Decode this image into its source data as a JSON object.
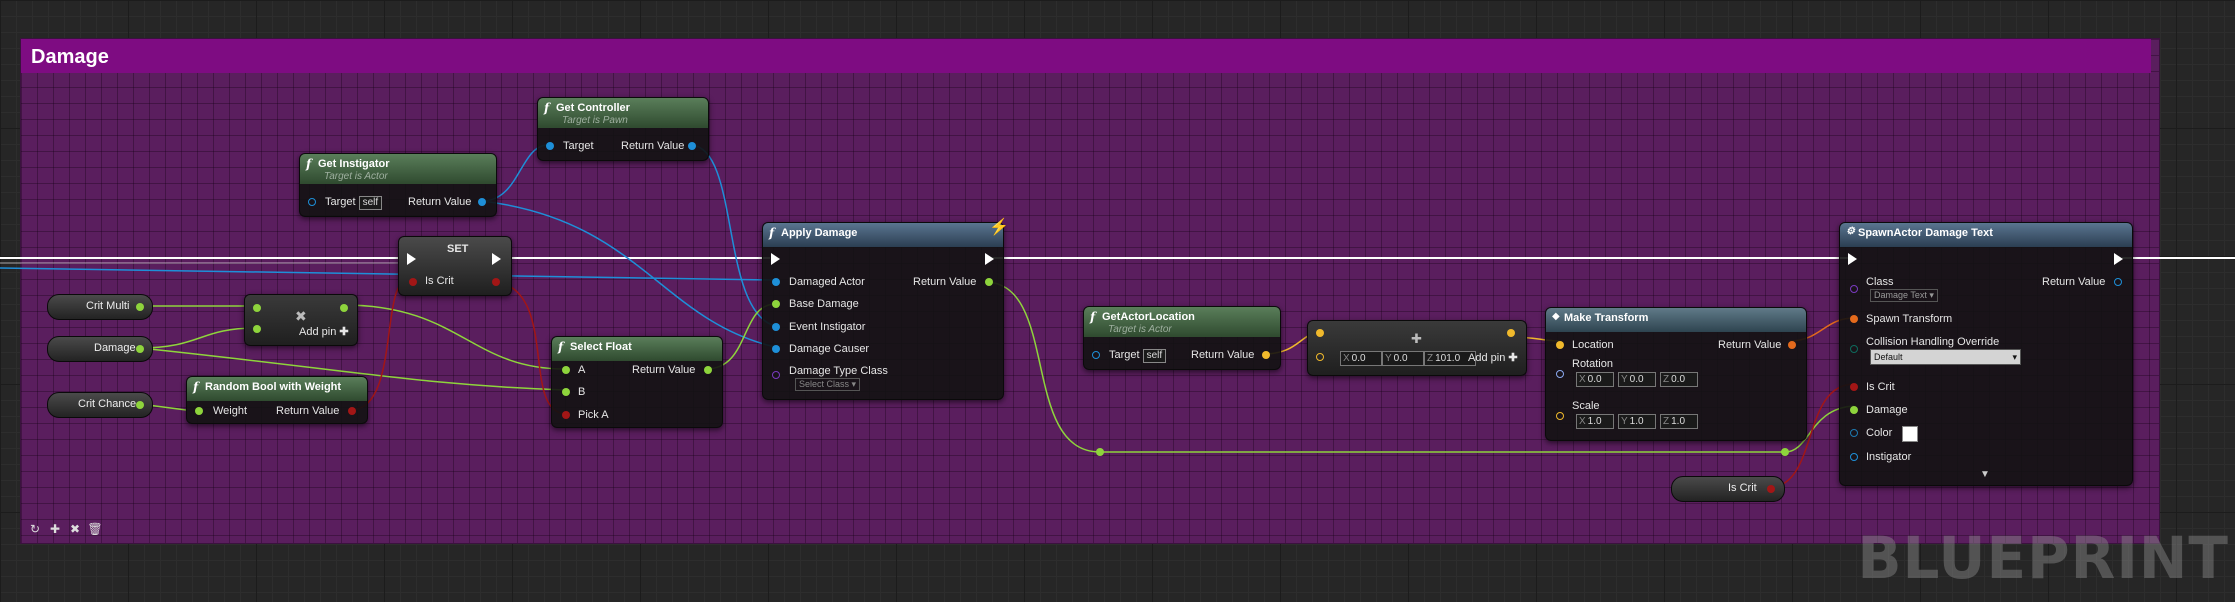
{
  "comment": {
    "title": "Damage"
  },
  "watermark": "BLUEPRINT",
  "colors": {
    "exec": "#ffffff",
    "object": "#1e8fd8",
    "float": "#8ed43c",
    "bool": "#a21616",
    "vector": "#f0b92c",
    "transform": "#e46a1c",
    "rotator": "#8ba9f0",
    "class": "#5a2a9a",
    "structure": "#1e7ab0"
  },
  "nodes": {
    "get_controller": {
      "title": "Get Controller",
      "subtitle": "Target is Pawn",
      "target": "Target",
      "ret": "Return Value"
    },
    "get_instigator": {
      "title": "Get Instigator",
      "subtitle": "Target is Actor",
      "target": "Target",
      "self": "self",
      "ret": "Return Value"
    },
    "set": {
      "title": "SET",
      "pin": "Is Crit"
    },
    "add": {
      "add_pin": "Add pin"
    },
    "random_bool": {
      "title": "Random Bool with Weight",
      "weight": "Weight",
      "ret": "Return Value"
    },
    "select_float": {
      "title": "Select Float",
      "a": "A",
      "b": "B",
      "pick": "Pick A",
      "ret": "Return Value"
    },
    "apply_damage": {
      "title": "Apply Damage",
      "damaged_actor": "Damaged Actor",
      "base_damage": "Base Damage",
      "event_instigator": "Event Instigator",
      "damage_causer": "Damage Causer",
      "damage_type": "Damage Type Class",
      "damage_type_value": "Select Class",
      "ret": "Return Value"
    },
    "get_actor_location": {
      "title": "GetActorLocation",
      "subtitle": "Target is Actor",
      "target": "Target",
      "self": "self",
      "ret": "Return Value"
    },
    "make_vector": {
      "x": "0.0",
      "y": "0.0",
      "z": "101.0",
      "add_pin": "Add pin"
    },
    "make_transform": {
      "title": "Make Transform",
      "location": "Location",
      "rotation": "Rotation",
      "scale": "Scale",
      "ret": "Return Value",
      "rot": {
        "x": "0.0",
        "y": "0.0",
        "z": "0.0"
      },
      "scl": {
        "x": "1.0",
        "y": "1.0",
        "z": "1.0"
      }
    },
    "spawn_actor": {
      "title": "SpawnActor Damage Text",
      "class": "Class",
      "class_value": "Damage Text",
      "spawn_transform": "Spawn Transform",
      "collision": "Collision Handling Override",
      "collision_value": "Default",
      "is_crit": "Is Crit",
      "damage": "Damage",
      "color": "Color",
      "instigator": "Instigator",
      "ret": "Return Value"
    }
  },
  "variables": {
    "crit_multi": "Crit Multi",
    "damage": "Damage",
    "crit_chance": "Crit Chance",
    "is_crit": "Is Crit"
  },
  "axis_labels": {
    "x": "X",
    "y": "Y",
    "z": "Z"
  }
}
